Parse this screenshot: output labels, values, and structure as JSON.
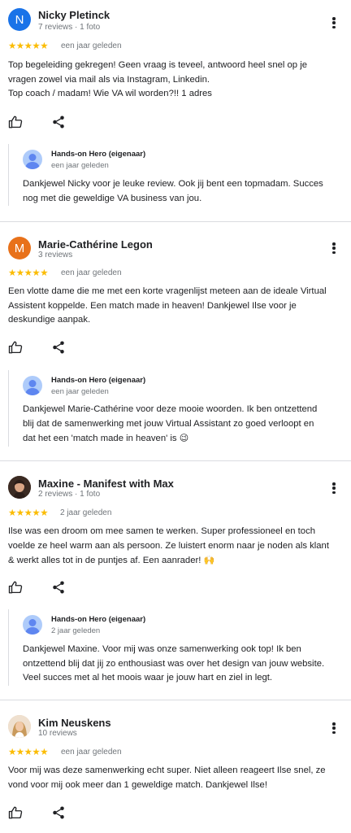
{
  "colors": {
    "star": "#fbbc04",
    "divider": "#dadce0",
    "meta": "#70757a",
    "owner_avatar": "#aecbfa"
  },
  "owner": {
    "name": "Hands-on Hero (eigenaar)"
  },
  "reviews": [
    {
      "avatar_letter": "N",
      "avatar_color": "#1a73e8",
      "name": "Nicky Pletinck",
      "meta": "7 reviews · 1 foto",
      "stars": "★★★★★",
      "ago": "een jaar geleden",
      "text_lines": [
        "Top begeleiding gekregen! Geen vraag is teveel, antwoord heel snel op je",
        "vragen zowel via mail als via Instagram, Linkedin.",
        "Top coach / madam! Wie VA wil worden?!! 1 adres"
      ],
      "reply_ago": "een jaar geleden",
      "reply_lines": [
        "Dankjewel Nicky voor je leuke review. Ook jij bent een topmadam. Succes",
        "nog met die geweldige VA business van jou."
      ]
    },
    {
      "avatar_letter": "M",
      "avatar_color": "#e8711a",
      "name": "Marie-Cathérine Legon",
      "meta": "3 reviews",
      "stars": "★★★★★",
      "ago": "een jaar geleden",
      "text_lines": [
        "Een vlotte dame die me met een korte vragenlijst meteen aan de ideale Virtual",
        "Assistent koppelde. Een match made in heaven! Dankjewel Ilse voor je",
        "deskundige aanpak."
      ],
      "reply_ago": "een jaar geleden",
      "reply_lines": [
        "Dankjewel Marie-Cathérine voor deze mooie woorden. Ik ben ontzettend",
        "blij dat de samenwerking met jouw Virtual Assistant zo goed verloopt en",
        "dat het een 'match made in heaven' is"
      ],
      "reply_emoji": "😉"
    },
    {
      "name": "Maxine - Manifest with Max",
      "meta": "2 reviews · 1 foto",
      "stars": "★★★★★",
      "ago": "2 jaar geleden",
      "text_lines": [
        "Ilse was een droom om mee samen te werken. Super professioneel en toch",
        "voelde ze heel warm aan als persoon. Ze luistert enorm naar je noden als klant",
        "& werkt alles tot in de puntjes af. Een aanrader!"
      ],
      "text_emoji": "🙌",
      "reply_ago": "2 jaar geleden",
      "reply_lines": [
        "Dankjewel Maxine. Voor mij was onze samenwerking ook top! Ik ben",
        "ontzettend blij dat jij zo enthousiast was over het design van jouw website.",
        "Veel succes met al het moois waar je jouw hart en ziel in legt."
      ]
    },
    {
      "name": "Kim Neuskens",
      "meta": "10 reviews",
      "stars": "★★★★★",
      "ago": "een jaar geleden",
      "text_lines": [
        "Voor mij was deze samenwerking echt super. Niet alleen reageert Ilse snel, ze",
        "vond voor mij ook meer dan 1 geweldige match. Dankjewel Ilse!"
      ]
    }
  ]
}
